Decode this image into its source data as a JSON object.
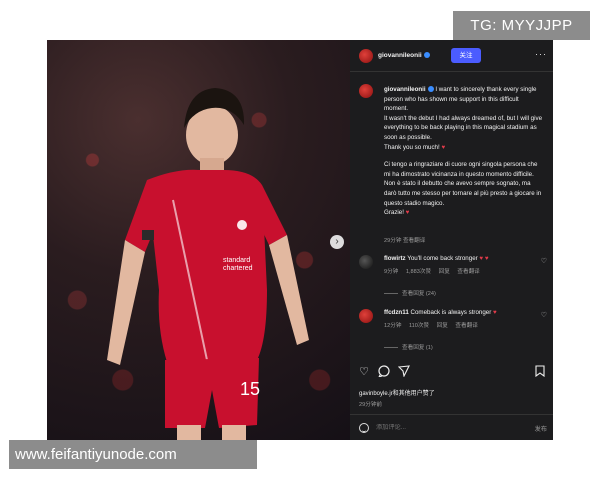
{
  "post": {
    "username": "giovannileonii",
    "follow_label": "关注",
    "more_label": "···",
    "caption_paragraphs": [
      "I want to sincerely thank every single person who has shown me support in this difficult moment.",
      "It wasn't the debut I had always dreamed of, but I will give everything to be back playing in this magical stadium as soon as possible.",
      "Thank you so much! ♥",
      "",
      "Ci tengo a ringraziare di cuore ogni singola persona che mi ha dimostrato vicinanza in questo momento difficile.",
      "Non è stato il debutto che avevo sempre sognato, ma darò tutto me stesso per tornare al più presto a giocare in questo stadio magico.",
      "Grazie! ♥"
    ],
    "caption_meta": "29分钟   查看翻译",
    "likers": "gavinboyle.jr和其他用户赞了",
    "date": "29分钟前",
    "comment_placeholder": "添加评论...",
    "post_button": "发布"
  },
  "comments": [
    {
      "user": "flowirtz",
      "text": "You'll come back stronger ♥ ♥",
      "time": "9分钟",
      "likes": "1,883次赞",
      "reply": "回复",
      "translate": "查看翻译",
      "replies": "查看回复 (24)"
    },
    {
      "user": "ffcdzn11",
      "text": "Comeback is always stronger ♥",
      "time": "12分钟",
      "likes": "110次赞",
      "reply": "回复",
      "translate": "查看翻译",
      "replies": "查看回复 (1)"
    }
  ],
  "icons": {
    "heart": "heart-icon",
    "comment": "comment-icon",
    "share": "share-icon",
    "save": "bookmark-icon",
    "next": "chevron-right-icon"
  },
  "colors": {
    "accent": "#4b5cff",
    "panel_bg": "#1c1c1e",
    "heart": "#e23b4a",
    "jersey": "#c8102e"
  },
  "watermarks": {
    "top_right": "TG: MYYJJPP",
    "bottom_left": "www.feifantiyunode.com"
  }
}
